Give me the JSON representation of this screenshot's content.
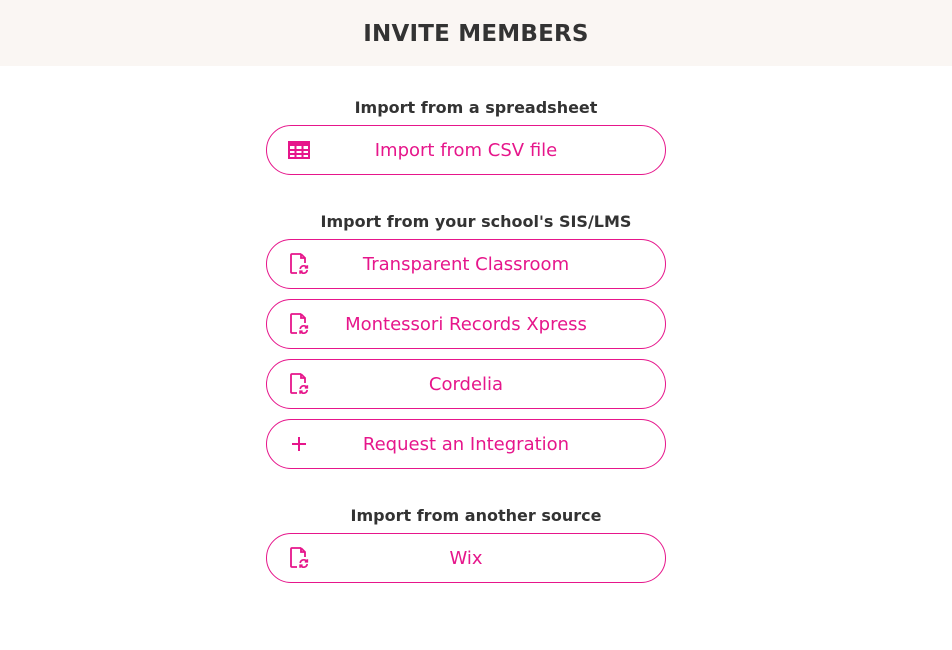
{
  "header": {
    "title": "INVITE MEMBERS"
  },
  "sections": {
    "spreadsheet": {
      "title": "Import from a spreadsheet",
      "buttons": [
        {
          "label": "Import from CSV file",
          "icon": "table-icon"
        }
      ]
    },
    "sis": {
      "title": "Import from your school's SIS/LMS",
      "buttons": [
        {
          "label": "Transparent Classroom",
          "icon": "file-sync-icon"
        },
        {
          "label": "Montessori Records Xpress",
          "icon": "file-sync-icon"
        },
        {
          "label": "Cordelia",
          "icon": "file-sync-icon"
        },
        {
          "label": "Request an Integration",
          "icon": "plus-icon"
        }
      ]
    },
    "other": {
      "title": "Import from another source",
      "buttons": [
        {
          "label": "Wix",
          "icon": "file-sync-icon"
        }
      ]
    }
  },
  "colors": {
    "accent": "#e6168b",
    "header_bg": "#faf6f3",
    "text": "#333333"
  }
}
